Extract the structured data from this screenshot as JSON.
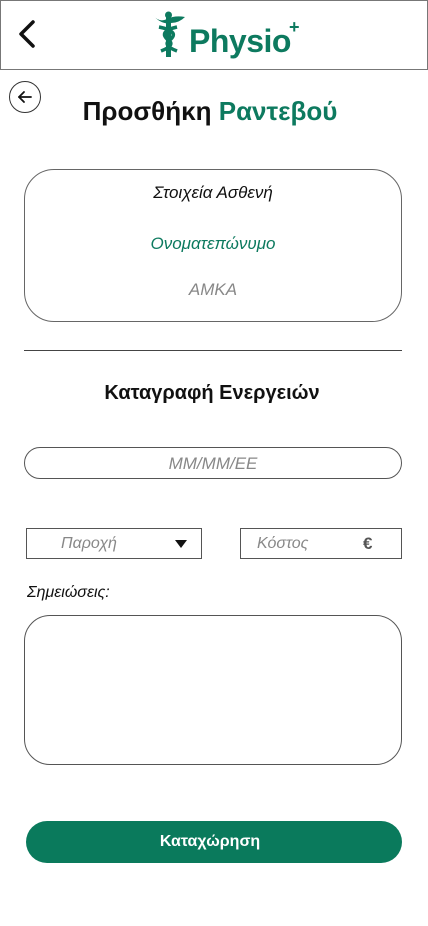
{
  "header": {
    "logo_text": "Physio",
    "logo_plus": "+"
  },
  "page": {
    "title_main": "Προσθήκη",
    "title_accent": "Ραντεβού"
  },
  "patient_card": {
    "heading": "Στοιχεία Ασθενή",
    "name_placeholder": "Ονοματεπώνυμο",
    "amka_placeholder": "ΑΜΚΑ"
  },
  "actions_section": {
    "title": "Καταγραφή Ενεργειών",
    "date_placeholder": "ΜΜ/ΜΜ/ΕΕ",
    "service_placeholder": "Παροχή",
    "cost_placeholder": "Κόστος",
    "currency_symbol": "€",
    "notes_label": "Σημειώσεις:"
  },
  "submit": {
    "label": "Καταχώρηση"
  },
  "colors": {
    "accent": "#0d7a5f",
    "button": "#0a7a5c"
  },
  "icons": {
    "back": "chevron-left-icon",
    "circle_back": "arrow-left-icon",
    "logo": "caduceus-icon",
    "dropdown": "caret-down-icon"
  }
}
